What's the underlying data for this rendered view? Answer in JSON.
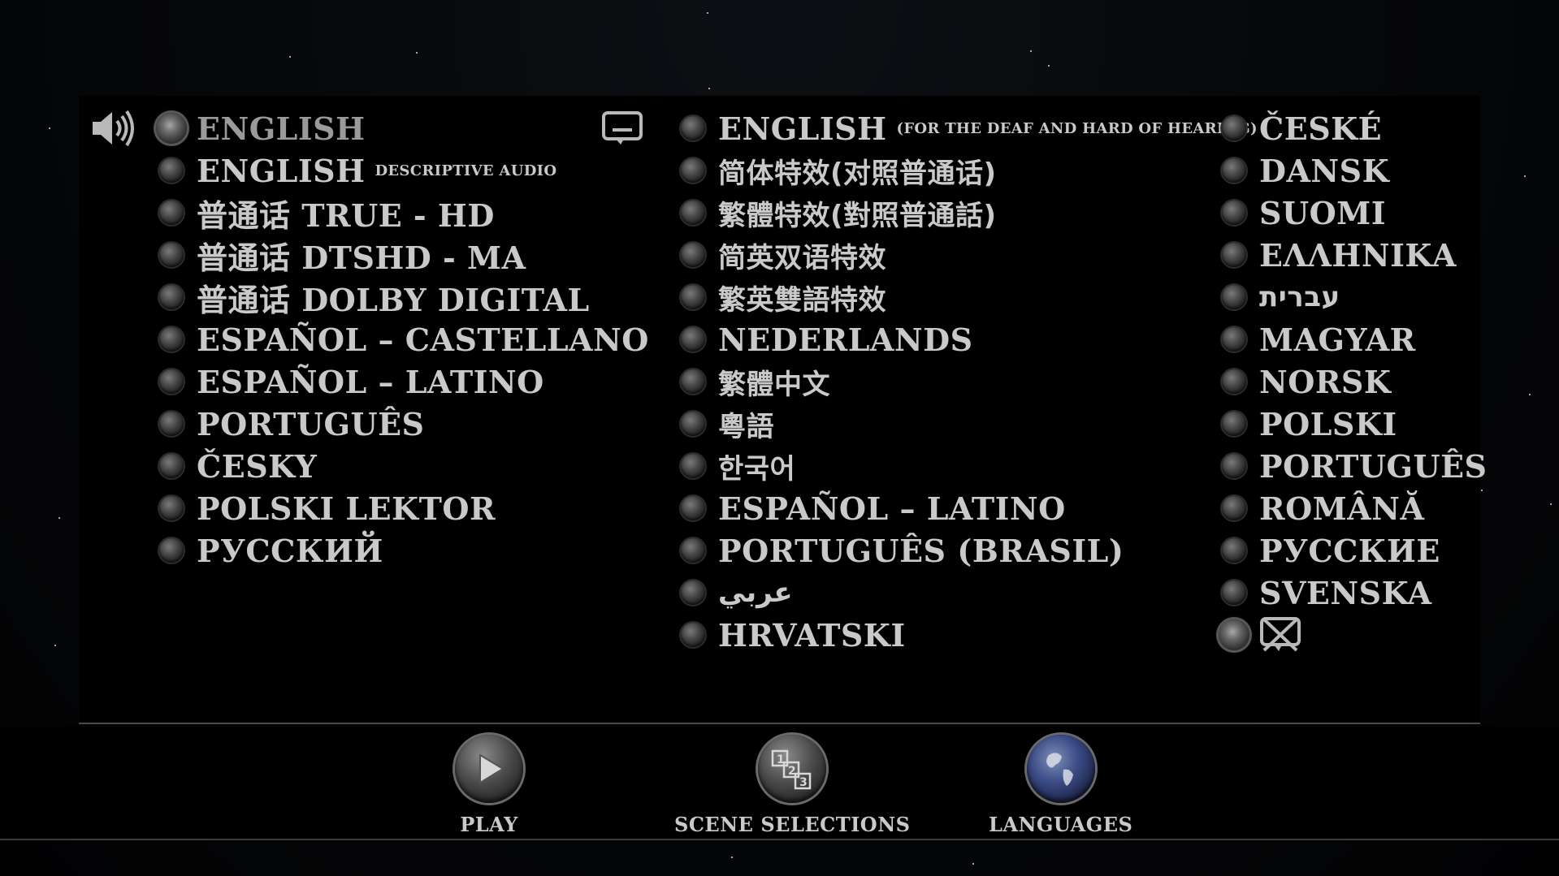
{
  "audio": {
    "icon": "speaker-icon",
    "items": [
      {
        "label": "ENGLISH",
        "sub": "",
        "selected": true
      },
      {
        "label": "ENGLISH",
        "sub": "DESCRIPTIVE AUDIO",
        "selected": false
      },
      {
        "label": "普通话 TRUE - HD",
        "sub": "",
        "selected": false
      },
      {
        "label": "普通话 DTSHD - MA",
        "sub": "",
        "selected": false
      },
      {
        "label": "普通话 DOLBY DIGITAL",
        "sub": "",
        "selected": false
      },
      {
        "label": "ESPAÑOL – CASTELLANO",
        "sub": "",
        "selected": false
      },
      {
        "label": "ESPAÑOL – LATINO",
        "sub": "",
        "selected": false
      },
      {
        "label": "PORTUGUÊS",
        "sub": "",
        "selected": false
      },
      {
        "label": "ČESKY",
        "sub": "",
        "selected": false
      },
      {
        "label": "POLSKI LEKTOR",
        "sub": "",
        "selected": false
      },
      {
        "label": "РУССКИЙ",
        "sub": "",
        "selected": false
      }
    ]
  },
  "subtitles_left": {
    "icon": "subtitle-icon",
    "items": [
      {
        "label": "ENGLISH",
        "sub": "(FOR THE DEAF AND HARD OF HEARING)"
      },
      {
        "label": "简体特效(对照普通话)",
        "sub": ""
      },
      {
        "label": "繁體特效(對照普通話)",
        "sub": ""
      },
      {
        "label": "简英双语特效",
        "sub": ""
      },
      {
        "label": "繁英雙語特效",
        "sub": ""
      },
      {
        "label": "NEDERLANDS",
        "sub": ""
      },
      {
        "label": "繁體中文",
        "sub": ""
      },
      {
        "label": "粵語",
        "sub": ""
      },
      {
        "label": "한국어",
        "sub": ""
      },
      {
        "label": "ESPAÑOL – LATINO",
        "sub": ""
      },
      {
        "label": "PORTUGUÊS (BRASIL)",
        "sub": ""
      },
      {
        "label": "عربي",
        "sub": ""
      },
      {
        "label": "HRVATSKI",
        "sub": ""
      }
    ]
  },
  "subtitles_right": {
    "items": [
      {
        "label": "ČESKÉ",
        "selected": false
      },
      {
        "label": "DANSK",
        "selected": false
      },
      {
        "label": "SUOMI",
        "selected": false
      },
      {
        "label": "ΕΛΛΗΝΙΚΑ",
        "selected": false
      },
      {
        "label": "עברית",
        "selected": false
      },
      {
        "label": "MAGYAR",
        "selected": false
      },
      {
        "label": "NORSK",
        "selected": false
      },
      {
        "label": "POLSKI",
        "selected": false
      },
      {
        "label": "PORTUGUÊS",
        "selected": false
      },
      {
        "label": "ROMÂNĂ",
        "selected": false
      },
      {
        "label": "РУССКИЕ",
        "selected": false
      },
      {
        "label": "SVENSKA",
        "selected": false
      }
    ],
    "none_option": {
      "icon": "subtitles-off-icon",
      "selected": true
    }
  },
  "navbar": {
    "play": {
      "label": "PLAY",
      "icon": "play-icon"
    },
    "scenes": {
      "label": "SCENE SELECTIONS",
      "icon": "scene-selections-icon"
    },
    "languages": {
      "label": "LANGUAGES",
      "icon": "globe-icon"
    }
  }
}
